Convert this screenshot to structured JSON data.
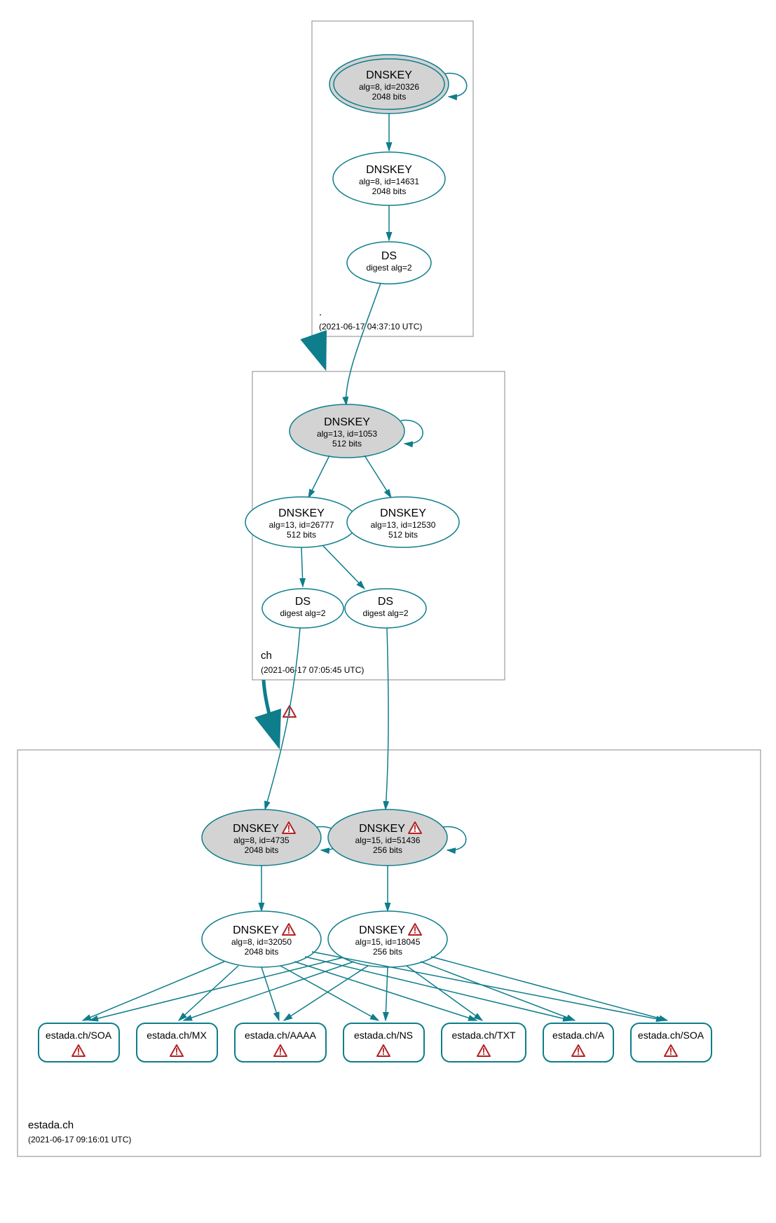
{
  "colors": {
    "accent": "#0e7d8c",
    "warn": "#b22222",
    "gray": "#d3d3d3"
  },
  "zones": {
    "root": {
      "label": ".",
      "ts": "(2021-06-17 04:37:10 UTC)"
    },
    "ch": {
      "label": "ch",
      "ts": "(2021-06-17 07:05:45 UTC)"
    },
    "estada": {
      "label": "estada.ch",
      "ts": "(2021-06-17 09:16:01 UTC)"
    }
  },
  "nodes": {
    "n1": {
      "l1": "DNSKEY",
      "l2": "alg=8, id=20326",
      "l3": "2048 bits"
    },
    "n2": {
      "l1": "DNSKEY",
      "l2": "alg=8, id=14631",
      "l3": "2048 bits"
    },
    "n3": {
      "l1": "DS",
      "l2": "digest alg=2"
    },
    "n4": {
      "l1": "DNSKEY",
      "l2": "alg=13, id=1053",
      "l3": "512 bits"
    },
    "n5": {
      "l1": "DNSKEY",
      "l2": "alg=13, id=26777",
      "l3": "512 bits"
    },
    "n6": {
      "l1": "DNSKEY",
      "l2": "alg=13, id=12530",
      "l3": "512 bits"
    },
    "n7": {
      "l1": "DS",
      "l2": "digest alg=2"
    },
    "n8": {
      "l1": "DS",
      "l2": "digest alg=2"
    },
    "n9": {
      "l1": "DNSKEY",
      "l2": "alg=8, id=4735",
      "l3": "2048 bits"
    },
    "n10": {
      "l1": "DNSKEY",
      "l2": "alg=15, id=51436",
      "l3": "256 bits"
    },
    "n11": {
      "l1": "DNSKEY",
      "l2": "alg=8, id=32050",
      "l3": "2048 bits"
    },
    "n12": {
      "l1": "DNSKEY",
      "l2": "alg=15, id=18045",
      "l3": "256 bits"
    }
  },
  "records": {
    "r1": "estada.ch/SOA",
    "r2": "estada.ch/MX",
    "r3": "estada.ch/AAAA",
    "r4": "estada.ch/NS",
    "r5": "estada.ch/TXT",
    "r6": "estada.ch/A",
    "r7": "estada.ch/SOA"
  }
}
